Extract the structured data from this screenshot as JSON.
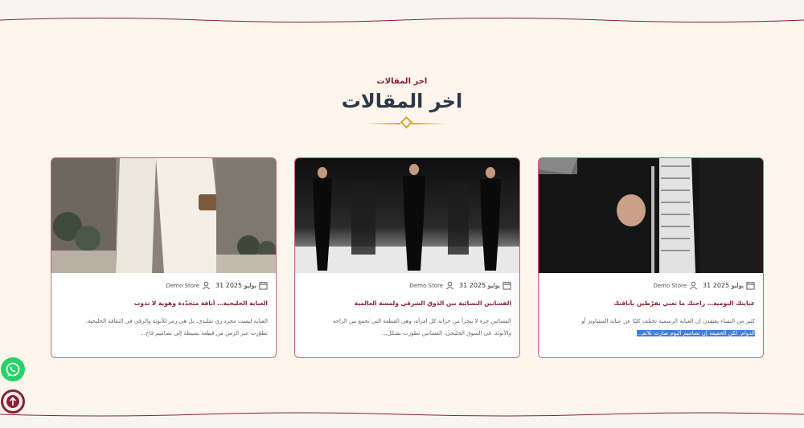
{
  "section": {
    "kicker": "اخر المقالات",
    "title": "اخر المقالات"
  },
  "colors": {
    "accent": "#8c1f33",
    "gold": "#d4a53a",
    "background": "#fef5ec",
    "heading": "#2c3747"
  },
  "posts": [
    {
      "date": "31 يوليو 2025",
      "author": "Demo Store",
      "title": "عبايتك اليومية… راحتك ما تعني تفرّطين بأناقتك",
      "excerpt_line1": "كثير من النساء يعتقدن إن العباية الرسمية تختلف كليًا عن عباية المشاوير أو",
      "excerpt_line2_selected": "الدوام. لكن الحقيقة إن تصاميم اليوم صارت تلائم..."
    },
    {
      "date": "31 يوليو 2025",
      "author": "Demo Store",
      "title": "الفساتين النسائية بين الذوق الشرقي ولمسة العالمية",
      "excerpt_line1": "الفساتين جزء لا يتجزأ من خزانة كل امرأة، وهي القطعة التي تجمع بين الراحة",
      "excerpt_line2": "والأنوثة. في السوق الخليجي، الفساتين تطورت بشكل..."
    },
    {
      "date": "31 يوليو 2025",
      "author": "Demo Store",
      "title": "العباية الخليجية… أناقة متجدّدة وهوية لا تذوب",
      "excerpt_line1": "العباية ليست مجرد زي تقليدي، بل هي رمز للأنوثة والرقي في الثقافة الخليجية.",
      "excerpt_line2": "تطوّرت عبر الزمن من قطعة بسيطة إلى تصاميم فاخ..."
    }
  ],
  "floating": {
    "whatsapp_icon": "whatsapp-icon",
    "scroll_icon": "arrow-up-icon"
  }
}
